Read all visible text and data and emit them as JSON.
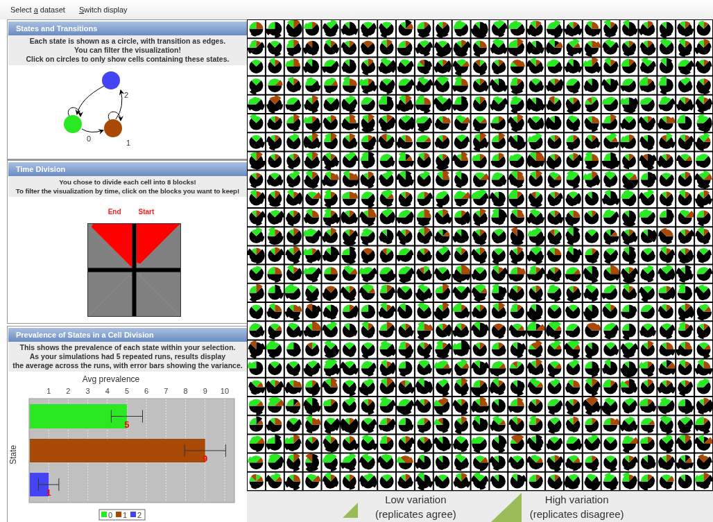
{
  "menu": [
    {
      "before": "Select ",
      "key": "a",
      "after": " dataset"
    },
    {
      "key": "S",
      "after": "witch display"
    }
  ],
  "states_panel": {
    "title": "States and Transitions",
    "description": [
      "Each state is shown as a circle, with transition as edges.",
      "You can filter the visualization!",
      "Click on circles to only show cells containing these states."
    ],
    "nodes": [
      {
        "label": "0",
        "color": "#2ae822"
      },
      {
        "label": "1",
        "color": "#a84a06"
      },
      {
        "label": "2",
        "color": "#4444f4"
      }
    ]
  },
  "time_panel": {
    "title": "Time Division",
    "description": [
      "You chose to divide each cell into 8 blocks!",
      "To filter the visualization by time, click on the blocks you want to keep!"
    ],
    "end_label": "End",
    "start_label": "Start",
    "blocks": [
      {
        "selected": true
      },
      {
        "selected": false
      },
      {
        "selected": false
      },
      {
        "selected": false
      },
      {
        "selected": false
      },
      {
        "selected": false
      },
      {
        "selected": false
      },
      {
        "selected": true
      }
    ]
  },
  "prevalence_panel": {
    "title": "Prevalence of States in a Cell Division",
    "description": [
      "This shows the prevalence of each state within your selection.",
      "As your simulations had 5 repeated runs, results display",
      "the average across the runs, with error bars showing the variance."
    ],
    "chart_data": {
      "type": "bar",
      "orientation": "horizontal",
      "xlabel": "Avg prevalence",
      "ylabel": "State",
      "series": [
        {
          "name": "0",
          "color": "#2ae822",
          "values": [
            5
          ],
          "errors": [
            0.8
          ]
        },
        {
          "name": "1",
          "color": "#a84a06",
          "values": [
            9
          ],
          "errors": [
            1.05
          ]
        },
        {
          "name": "2",
          "color": "#4444f4",
          "values": [
            1
          ],
          "errors": [
            0.52
          ]
        }
      ],
      "xticks": [
        1,
        2,
        3,
        4,
        5,
        6,
        7,
        8,
        9,
        10
      ],
      "xlim": [
        0,
        10.5
      ],
      "grid": true,
      "data_labels": true,
      "legend": "bottom"
    }
  },
  "variation_legend": [
    {
      "kind": "low",
      "label": [
        "Low variation",
        "(replicates agree)"
      ]
    },
    {
      "kind": "high",
      "label": [
        "High variation",
        "(replicates disagree)"
      ]
    }
  ]
}
